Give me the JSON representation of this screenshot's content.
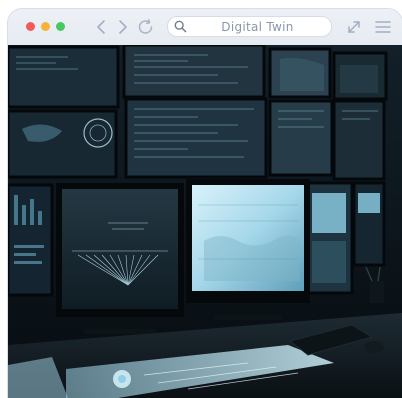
{
  "browser": {
    "controls": {
      "close_color": "#f25a5a",
      "minimize_color": "#f7b23a",
      "maximize_color": "#49c761"
    },
    "nav": {
      "back_icon": "chevron-left-icon",
      "forward_icon": "chevron-right-icon",
      "reload_icon": "reload-icon"
    },
    "search": {
      "value": "Digital Twin",
      "icon": "search-icon"
    },
    "tools": {
      "expand_icon": "expand-icon",
      "menu_icon": "hamburger-menu-icon"
    }
  },
  "content": {
    "scene": "control-room-monitors",
    "accent_color": "#8fd0e8"
  }
}
